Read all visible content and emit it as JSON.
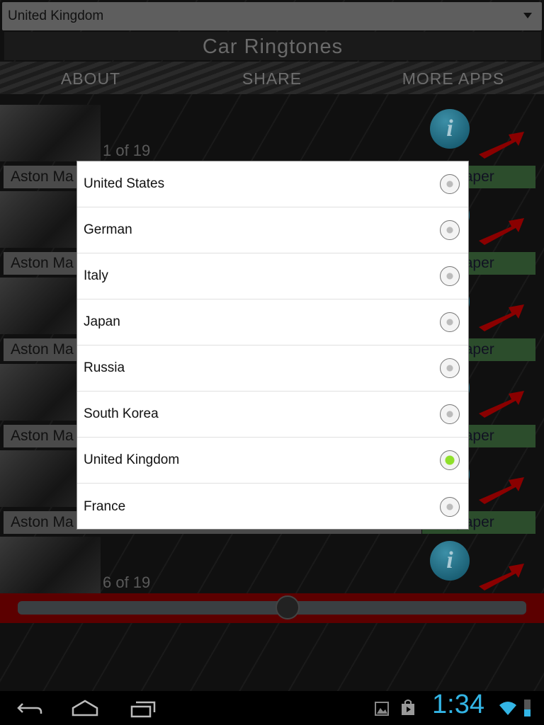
{
  "spinner": {
    "selected": "United Kingdom"
  },
  "header": {
    "title": "Car Ringtones"
  },
  "tabs": [
    {
      "label": "ABOUT"
    },
    {
      "label": "SHARE"
    },
    {
      "label": "MORE APPS"
    }
  ],
  "list": [
    {
      "count": "1 of 19",
      "name": "Aston Ma",
      "wallpaper": "Wallpaper"
    },
    {
      "count": "",
      "name": "Aston Ma",
      "wallpaper": "Wallpaper"
    },
    {
      "count": "",
      "name": "Aston Ma",
      "wallpaper": "Wallpaper"
    },
    {
      "count": "",
      "name": "Aston Ma",
      "wallpaper": "Wallpaper"
    },
    {
      "count": "",
      "name": "Aston Ma",
      "wallpaper": "Wallpaper"
    },
    {
      "count": "6 of 19",
      "name": "",
      "wallpaper": ""
    }
  ],
  "seekbar": {
    "progress_percent": 53
  },
  "dialog": {
    "options": [
      {
        "label": "United States",
        "selected": false
      },
      {
        "label": "German",
        "selected": false
      },
      {
        "label": "Italy",
        "selected": false
      },
      {
        "label": "Japan",
        "selected": false
      },
      {
        "label": "Russia",
        "selected": false
      },
      {
        "label": "South Korea",
        "selected": false
      },
      {
        "label": "United Kingdom",
        "selected": true
      },
      {
        "label": "France",
        "selected": false
      }
    ]
  },
  "statusbar": {
    "time": "1:34"
  },
  "colors": {
    "accent": "#33b5e5",
    "radio_selected": "#8fe02a",
    "seekbar_bg": "#5c0000"
  }
}
